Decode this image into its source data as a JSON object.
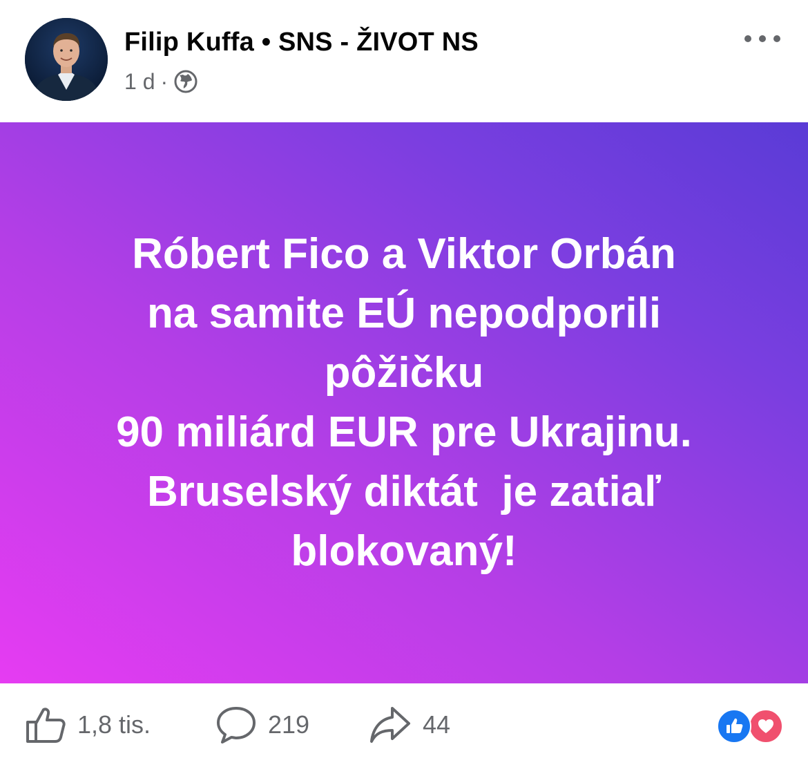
{
  "post": {
    "author": "Filip Kuffa • SNS - ŽIVOT NS",
    "time": "1 d",
    "dot": "·",
    "privacy_icon": "globe-icon",
    "more_icon": "more-options-icon"
  },
  "card": {
    "text": "Róbert Fico a Viktor Orbán\nna samite EÚ nepodporili\npôžičku\n90 miliárd EUR pre Ukrajinu.\nBruselský diktát  je zatiaľ\nblokovaný!",
    "gradient_colors": [
      "#e63cf2",
      "#b43ee6",
      "#7a3ee0",
      "#5a3bd6"
    ],
    "text_color": "#ffffff"
  },
  "footer": {
    "likes": "1,8 tis.",
    "comments": "219",
    "shares": "44",
    "like_icon": "thumbs-up-icon",
    "comment_icon": "comment-bubble-icon",
    "share_icon": "share-arrow-icon",
    "reactions": [
      "like-reaction-icon",
      "love-reaction-icon"
    ],
    "reaction_colors": {
      "like": "#1877f2",
      "love": "#f0506e"
    }
  },
  "colors": {
    "primary_text": "#050505",
    "secondary_text": "#65676b"
  }
}
